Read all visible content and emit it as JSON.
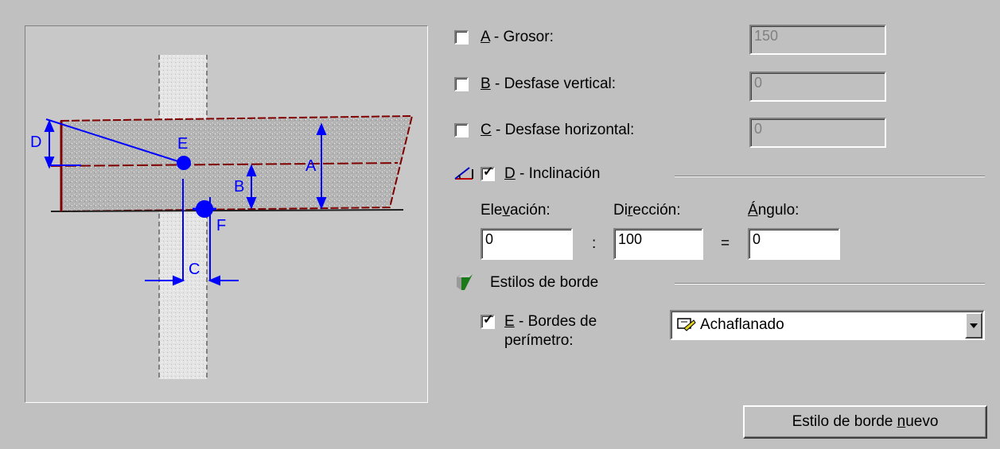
{
  "fields": {
    "a": {
      "label_key": "A",
      "label_rest": " - Grosor:",
      "value": "150",
      "checked": false
    },
    "b": {
      "label_key": "B",
      "label_rest": " - Desfase vertical:",
      "value": "0",
      "checked": false
    },
    "c": {
      "label_key": "C",
      "label_rest": " - Desfase horizontal:",
      "value": "0",
      "checked": false
    }
  },
  "inclination": {
    "label_key": "D",
    "label_rest": " - Inclinación",
    "checked": true,
    "elevation_label_pre": "Ele",
    "elevation_label_key": "v",
    "elevation_label_post": "ación:",
    "direction_label_pre": "Di",
    "direction_label_key": "r",
    "direction_label_post": "ección:",
    "angle_label_key": "Á",
    "angle_label_post": "ngulo:",
    "elevation": "0",
    "direction": "100",
    "angle": "0",
    "colon": ":",
    "equals": "="
  },
  "edge_styles": {
    "section_label": "Estilos de borde",
    "perimeter_key": "E",
    "perimeter_rest": " - Bordes de",
    "perimeter_line2": "perímetro:",
    "perimeter_checked": true,
    "style_selected": "Achaflanado",
    "new_button_pre": "Estilo de borde ",
    "new_button_key": "n",
    "new_button_post": "uevo"
  },
  "diagram_labels": {
    "a": "A",
    "b": "B",
    "c": "C",
    "d": "D",
    "e": "E",
    "f": "F"
  },
  "colors": {
    "annotation": "#0000ff",
    "slab": "#a0a0a0",
    "edge": "#800000"
  },
  "icons": {
    "inclination": "inclination-icon",
    "edge_style": "edge-style-icon",
    "dropdown_item": "paint-icon",
    "dropdown_arrow": "chevron-down-icon"
  }
}
